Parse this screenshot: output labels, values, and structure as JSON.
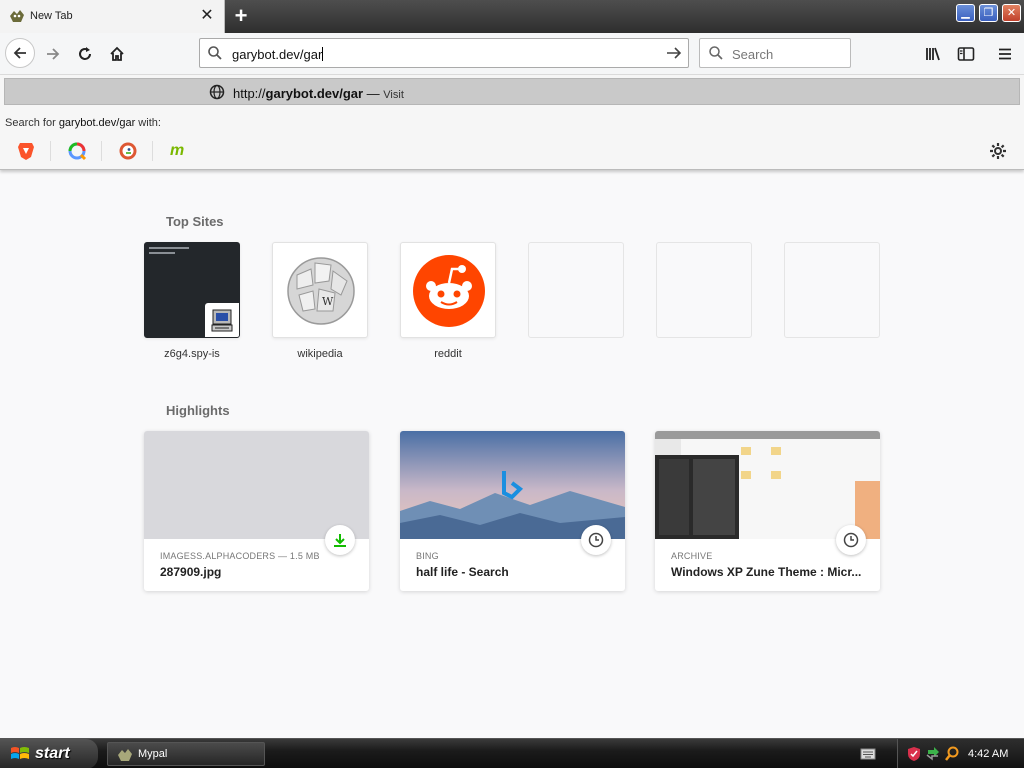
{
  "tab": {
    "title": "New Tab",
    "close_symbol": "✕"
  },
  "newtab_symbol": "+",
  "window_buttons": {
    "minimize": "▁",
    "maximize": "❐",
    "close": "✕"
  },
  "urlbar": {
    "value": "garybot.dev/gar"
  },
  "searchbar": {
    "placeholder": "Search"
  },
  "suggestion": {
    "prefix": "http://",
    "bold": "garybot.dev/gar",
    "separator": " — ",
    "action": "Visit"
  },
  "search_with": {
    "prefix": "Search for ",
    "query": "garybot.dev/gar",
    "suffix": " with:"
  },
  "engines": [
    "brave-icon",
    "qwant-icon",
    "duckduckgo-icon",
    "mojeek-icon"
  ],
  "engine_glyphs": {
    "mojeek": "m"
  },
  "top_sites_title": "Top Sites",
  "top_sites": [
    {
      "label": "z6g4.spy-is"
    },
    {
      "label": "wikipedia"
    },
    {
      "label": "reddit"
    },
    {
      "label": ""
    },
    {
      "label": ""
    },
    {
      "label": ""
    }
  ],
  "highlights_title": "Highlights",
  "highlights": [
    {
      "context": "IMAGESS.ALPHACODERS — 1.5 MB",
      "title": "287909.jpg",
      "badge": "download-icon"
    },
    {
      "context": "BING",
      "title": "half life - Search",
      "badge": "clock-icon"
    },
    {
      "context": "ARCHIVE",
      "title": "Windows XP Zune Theme : Micr...",
      "badge": "clock-icon"
    }
  ],
  "wiki_glyph": "W",
  "taskbar": {
    "start": "start",
    "task": "Mypal",
    "clock": "4:42 AM"
  },
  "colors": {
    "reddit": "#ff4500",
    "accent_green": "#12bc00",
    "bing_blue": "#1a8fe0"
  }
}
